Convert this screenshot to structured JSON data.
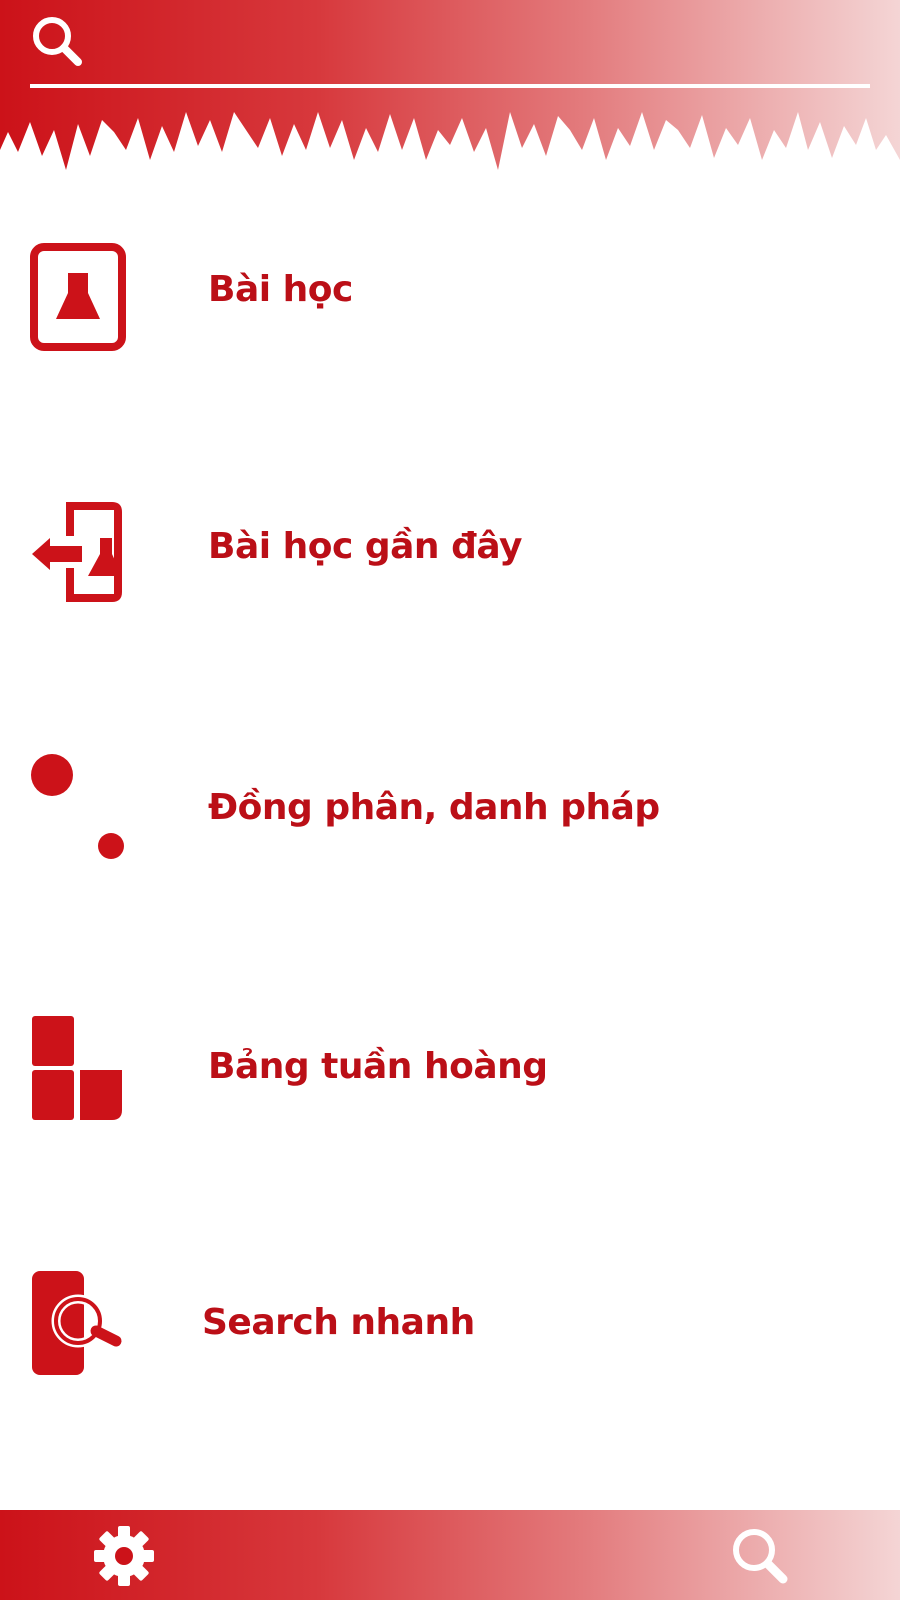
{
  "header": {
    "search_icon": "search-icon",
    "search_placeholder": ""
  },
  "menu": {
    "items": [
      {
        "label": "Bài học",
        "icon": "lesson-flask-icon"
      },
      {
        "label": "Bài học gần đây",
        "icon": "recent-lesson-icon"
      },
      {
        "label": "Đồng phân, danh pháp",
        "icon": "isomer-dots-icon"
      },
      {
        "label": "Bảng tuần hoàng",
        "icon": "periodic-table-icon"
      },
      {
        "label": "Search nhanh",
        "icon": "quick-search-icon"
      }
    ]
  },
  "footer": {
    "settings_icon": "gear-icon",
    "search_icon": "search-icon"
  },
  "colors": {
    "accent": "#cc1219",
    "label": "#bb0f17",
    "gradient_end": "#f4d5d5",
    "background": "#ffffff"
  }
}
